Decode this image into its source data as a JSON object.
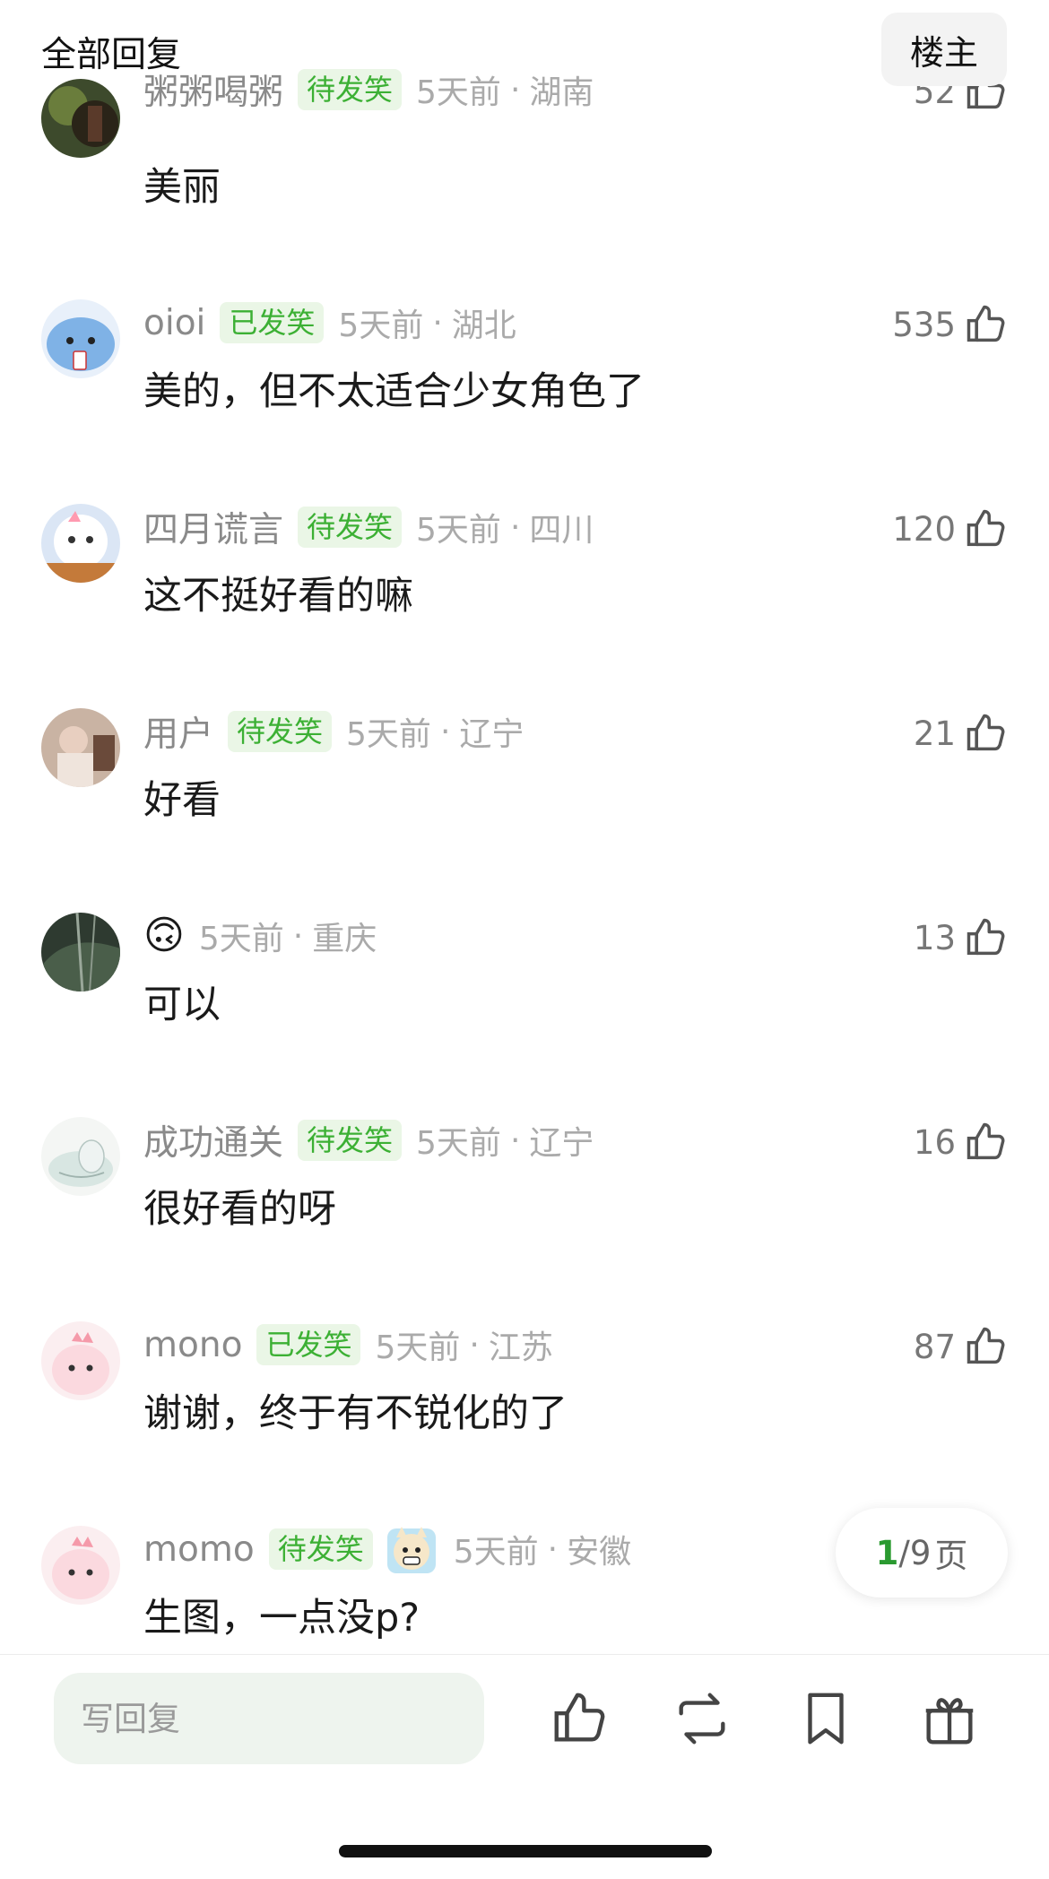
{
  "header": {
    "title": "全部回复",
    "owner_button": "楼主"
  },
  "comments": [
    {
      "name": "粥粥喝粥",
      "badge": "待发笑",
      "time": "5天前",
      "region": "湖南",
      "likes": "52",
      "text": "美丽",
      "avatar": "nature-photo-avatar"
    },
    {
      "name": "oioi",
      "badge": "已发笑",
      "time": "5天前",
      "region": "湖北",
      "likes": "535",
      "text": "美的，但不太适合少女角色了",
      "avatar": "blue-cartoon-avatar"
    },
    {
      "name": "四月谎言",
      "badge": "待发笑",
      "time": "5天前",
      "region": "四川",
      "likes": "120",
      "text": "这不挺好看的嘛",
      "avatar": "cat-cartoon-avatar"
    },
    {
      "name": "用户",
      "badge": "待发笑",
      "time": "5天前",
      "region": "辽宁",
      "likes": "21",
      "text": "好看",
      "avatar": "portrait-photo-avatar"
    },
    {
      "name": "",
      "emoji": "🙃",
      "time": "5天前",
      "region": "重庆",
      "likes": "13",
      "text": "可以",
      "avatar": "forest-photo-avatar"
    },
    {
      "name": "成功通关",
      "badge": "待发笑",
      "time": "5天前",
      "region": "辽宁",
      "likes": "16",
      "text": "很好看的呀",
      "avatar": "sleeping-cartoon-avatar"
    },
    {
      "name": "mono",
      "badge": "已发笑",
      "time": "5天前",
      "region": "江苏",
      "likes": "87",
      "text": "谢谢，终于有不锐化的了",
      "avatar": "pink-dino-avatar"
    },
    {
      "name": "momo",
      "badge": "待发笑",
      "sticker": "cat-sticker-icon",
      "time": "5天前",
      "region": "安徽",
      "likes": "",
      "text": "生图，一点没p?",
      "avatar": "pink-dino-avatar"
    }
  ],
  "pagination": {
    "current": "1",
    "total": "/9",
    "unit": "页"
  },
  "bottom": {
    "reply_placeholder": "写回复"
  },
  "colors": {
    "badge_green": "#3cb034",
    "badge_bg": "#eaf6e6",
    "page_current": "#2a9a30"
  }
}
